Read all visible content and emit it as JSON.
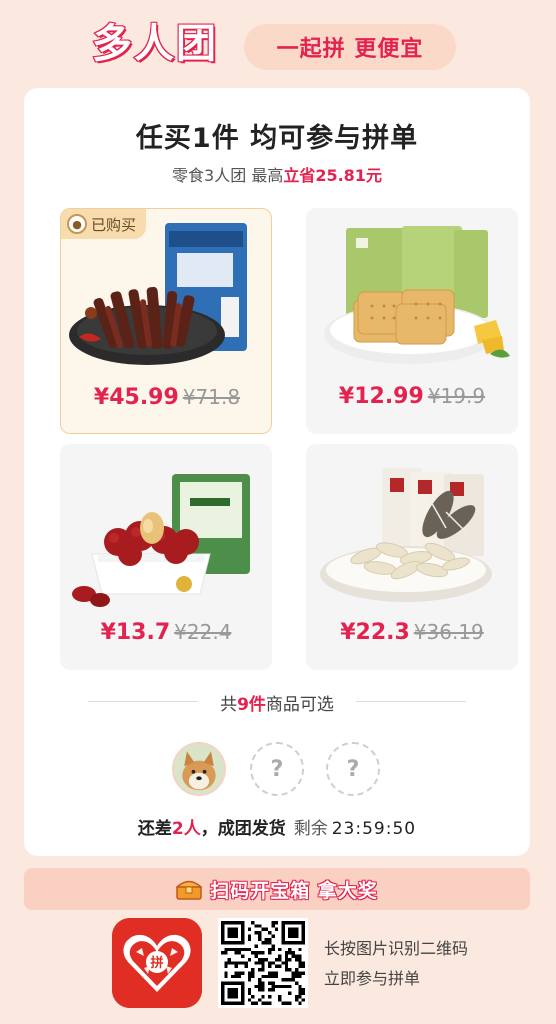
{
  "header": {
    "brand": "多人团",
    "slogan": "一起拼 更便宜"
  },
  "main": {
    "title": "任买1件 均可参与拼单",
    "subtitle_prefix": "零食3人团 最高",
    "subtitle_highlight": "立省25.81元"
  },
  "products": [
    {
      "price": "¥45.99",
      "original": "¥71.8",
      "badge": "已购买",
      "bought": true
    },
    {
      "price": "¥12.99",
      "original": "¥19.9"
    },
    {
      "price": "¥13.7",
      "original": "¥22.4"
    },
    {
      "price": "¥22.3",
      "original": "¥36.19"
    }
  ],
  "count": {
    "prefix": "共",
    "number": "9件",
    "suffix": "商品可选"
  },
  "members": {
    "slot_placeholder": "?"
  },
  "status": {
    "need_prefix": "还差",
    "need_number": "2人",
    "need_suffix": "，成团发货",
    "remain_label": "剩余",
    "timer": "23:59:50"
  },
  "banner": {
    "text": "扫码开宝箱 拿大奖"
  },
  "footer": {
    "logo_glyph": "拼",
    "hint_line1": "长按图片识别二维码",
    "hint_line2": "立即参与拼单"
  },
  "colors": {
    "accent": "#e3234f",
    "background": "#fbe9df",
    "card": "#ffffff",
    "logo_red": "#e02e24"
  }
}
